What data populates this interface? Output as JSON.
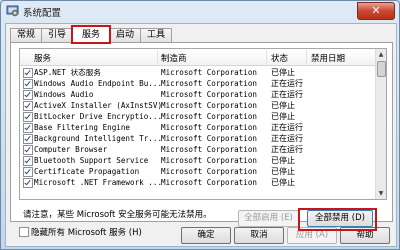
{
  "window": {
    "title": "系统配置",
    "close_label": "✕"
  },
  "tabs": [
    {
      "label": "常规"
    },
    {
      "label": "引导"
    },
    {
      "label": "服务"
    },
    {
      "label": "启动"
    },
    {
      "label": "工具"
    }
  ],
  "active_tab": "服务",
  "table": {
    "columns": [
      "服务",
      "制造商",
      "状态",
      "禁用日期"
    ],
    "rows": [
      {
        "service": "ASP.NET 状态服务",
        "manufacturer": "Microsoft Corporation",
        "status": "已停止",
        "checked": true
      },
      {
        "service": "Windows Audio Endpoint Bu...",
        "manufacturer": "Microsoft Corporation",
        "status": "正在运行",
        "checked": true
      },
      {
        "service": "Windows Audio",
        "manufacturer": "Microsoft Corporation",
        "status": "正在运行",
        "checked": true
      },
      {
        "service": "ActiveX Installer (AxInstSV)",
        "manufacturer": "Microsoft Corporation",
        "status": "已停止",
        "checked": true
      },
      {
        "service": "BitLocker Drive Encryptio...",
        "manufacturer": "Microsoft Corporation",
        "status": "已停止",
        "checked": true
      },
      {
        "service": "Base Filtering Engine",
        "manufacturer": "Microsoft Corporation",
        "status": "正在运行",
        "checked": true
      },
      {
        "service": "Background Intelligent Tr...",
        "manufacturer": "Microsoft Corporation",
        "status": "正在运行",
        "checked": true
      },
      {
        "service": "Computer Browser",
        "manufacturer": "Microsoft Corporation",
        "status": "正在运行",
        "checked": true
      },
      {
        "service": "Bluetooth Support Service",
        "manufacturer": "Microsoft Corporation",
        "status": "已停止",
        "checked": true
      },
      {
        "service": "Certificate Propagation",
        "manufacturer": "Microsoft Corporation",
        "status": "已停止",
        "checked": true
      },
      {
        "service": "Microsoft .NET Framework ...",
        "manufacturer": "Microsoft Corporation",
        "status": "已停止",
        "checked": true
      }
    ]
  },
  "note": "请注意，某些 Microsoft 安全服务可能无法禁用。",
  "buttons": {
    "enable_all": "全部启用 (E)",
    "disable_all": "全部禁用 (D)",
    "ok": "确定",
    "cancel": "取消",
    "apply": "应用 (A)",
    "help": "帮助"
  },
  "hide_ms": {
    "label": "隐藏所有 Microsoft 服务 (H)",
    "checked": false
  },
  "colors": {
    "highlight": "#c8151b"
  }
}
